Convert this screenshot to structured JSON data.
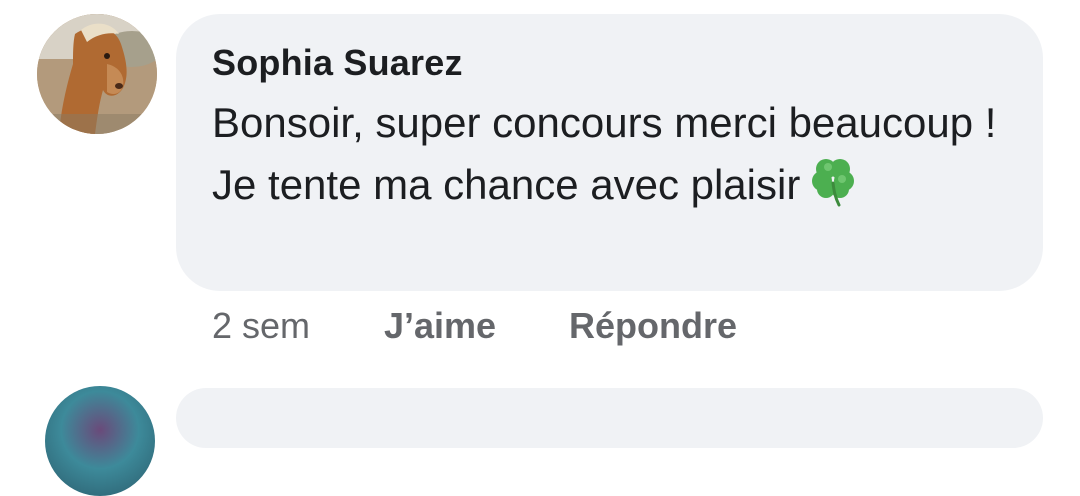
{
  "comment": {
    "author": "Sophia Suarez",
    "text": "Bonsoir, super concours merci beaucoup ! Je tente ma chance avec plaisir",
    "emoji_icon": "four-leaf-clover-icon",
    "timestamp": "2 sem",
    "like_label": "J’aime",
    "reply_label": "Répondre"
  },
  "colors": {
    "bubble_bg": "#f0f2f5",
    "text": "#1c1e21",
    "secondary": "#65676b",
    "clover": "#5cb85c"
  }
}
